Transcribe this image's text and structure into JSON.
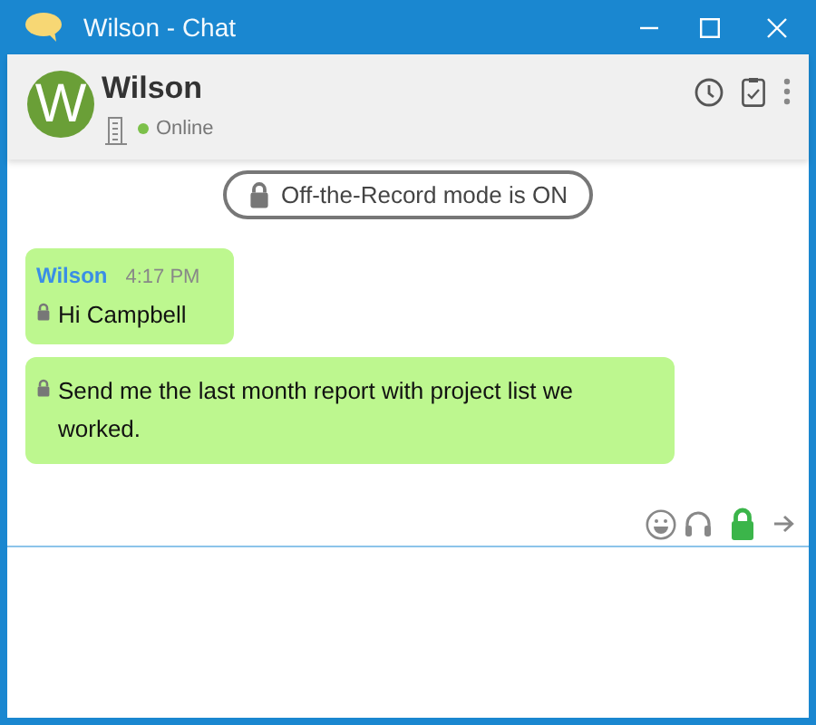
{
  "window": {
    "title": "Wilson - Chat"
  },
  "contact": {
    "initial": "W",
    "name": "Wilson",
    "status": "Online",
    "online": true
  },
  "otr_notice": {
    "label": "Off-the-Record mode is ON"
  },
  "messages": [
    {
      "sender": "Wilson",
      "time": "4:17 PM",
      "text": "Hi Campbell",
      "locked": true
    },
    {
      "text": "Send me the last month report with project list we worked.",
      "locked": true
    }
  ],
  "composer": {
    "encrypted": true
  }
}
